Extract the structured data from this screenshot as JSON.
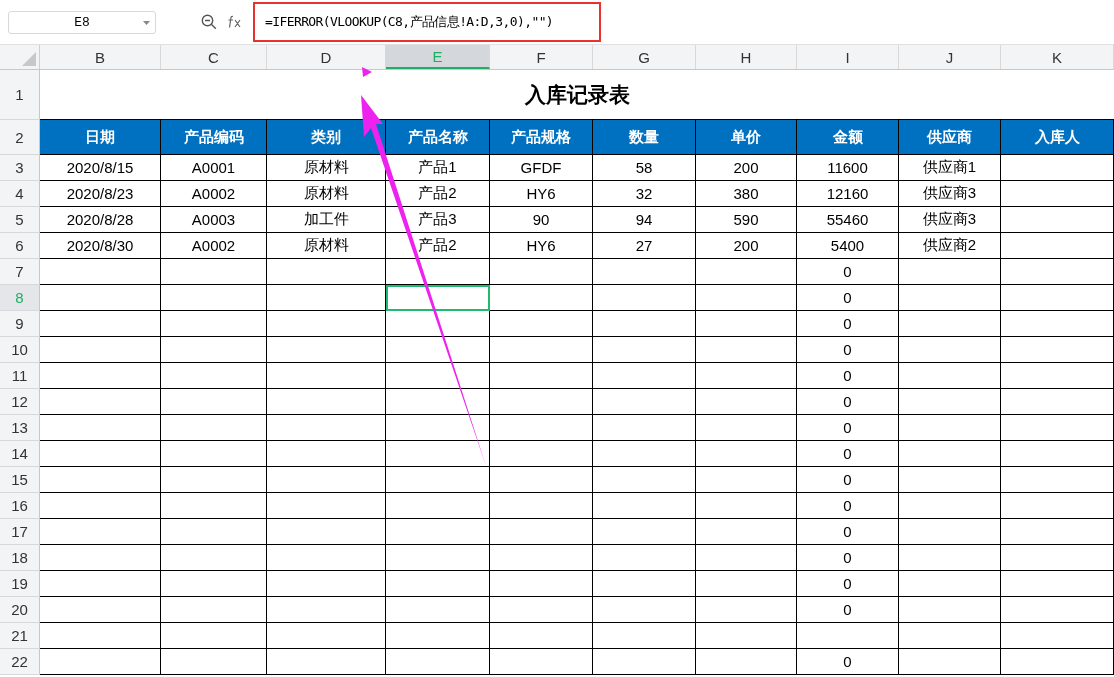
{
  "name_box": {
    "value": "E8"
  },
  "formula": "=IFERROR(VLOOKUP(C8,产品信息!A:D,3,0),\"\")",
  "columns": [
    {
      "label": "B",
      "selected": false
    },
    {
      "label": "C",
      "selected": false
    },
    {
      "label": "D",
      "selected": false
    },
    {
      "label": "E",
      "selected": true
    },
    {
      "label": "F",
      "selected": false
    },
    {
      "label": "G",
      "selected": false
    },
    {
      "label": "H",
      "selected": false
    },
    {
      "label": "I",
      "selected": false
    },
    {
      "label": "J",
      "selected": false
    },
    {
      "label": "K",
      "selected": false
    }
  ],
  "title_row": {
    "number": "1",
    "title": "入库记录表"
  },
  "header_row": {
    "number": "2",
    "cells": [
      "日期",
      "产品编码",
      "类别",
      "产品名称",
      "产品规格",
      "数量",
      "单价",
      "金额",
      "供应商",
      "入库人"
    ]
  },
  "rows": [
    {
      "number": "3",
      "selected": false,
      "cells": [
        "2020/8/15",
        "A0001",
        "原材料",
        "产品1",
        "GFDF",
        "58",
        "200",
        "11600",
        "供应商1",
        null
      ]
    },
    {
      "number": "4",
      "selected": false,
      "cells": [
        "2020/8/23",
        "A0002",
        "原材料",
        "产品2",
        "HY6",
        "32",
        "380",
        "12160",
        "供应商3",
        null
      ]
    },
    {
      "number": "5",
      "selected": false,
      "cells": [
        "2020/8/28",
        "A0003",
        "加工件",
        "产品3",
        "90",
        "94",
        "590",
        "55460",
        "供应商3",
        null
      ]
    },
    {
      "number": "6",
      "selected": false,
      "cells": [
        "2020/8/30",
        "A0002",
        "原材料",
        "产品2",
        "HY6",
        "27",
        "200",
        "5400",
        "供应商2",
        null
      ]
    },
    {
      "number": "7",
      "selected": false,
      "cells": [
        null,
        null,
        null,
        null,
        null,
        null,
        null,
        "0",
        null,
        null
      ]
    },
    {
      "number": "8",
      "selected": true,
      "cells": [
        null,
        null,
        null,
        null,
        null,
        null,
        null,
        "0",
        null,
        null
      ]
    },
    {
      "number": "9",
      "selected": false,
      "cells": [
        null,
        null,
        null,
        null,
        null,
        null,
        null,
        "0",
        null,
        null
      ]
    },
    {
      "number": "10",
      "selected": false,
      "cells": [
        null,
        null,
        null,
        null,
        null,
        null,
        null,
        "0",
        null,
        null
      ]
    },
    {
      "number": "11",
      "selected": false,
      "cells": [
        null,
        null,
        null,
        null,
        null,
        null,
        null,
        "0",
        null,
        null
      ]
    },
    {
      "number": "12",
      "selected": false,
      "cells": [
        null,
        null,
        null,
        null,
        null,
        null,
        null,
        "0",
        null,
        null
      ]
    },
    {
      "number": "13",
      "selected": false,
      "cells": [
        null,
        null,
        null,
        null,
        null,
        null,
        null,
        "0",
        null,
        null
      ]
    },
    {
      "number": "14",
      "selected": false,
      "cells": [
        null,
        null,
        null,
        null,
        null,
        null,
        null,
        "0",
        null,
        null
      ]
    },
    {
      "number": "15",
      "selected": false,
      "cells": [
        null,
        null,
        null,
        null,
        null,
        null,
        null,
        "0",
        null,
        null
      ]
    },
    {
      "number": "16",
      "selected": false,
      "cells": [
        null,
        null,
        null,
        null,
        null,
        null,
        null,
        "0",
        null,
        null
      ]
    },
    {
      "number": "17",
      "selected": false,
      "cells": [
        null,
        null,
        null,
        null,
        null,
        null,
        null,
        "0",
        null,
        null
      ]
    },
    {
      "number": "18",
      "selected": false,
      "cells": [
        null,
        null,
        null,
        null,
        null,
        null,
        null,
        "0",
        null,
        null
      ]
    },
    {
      "number": "19",
      "selected": false,
      "cells": [
        null,
        null,
        null,
        null,
        null,
        null,
        null,
        "0",
        null,
        null
      ]
    },
    {
      "number": "20",
      "selected": false,
      "cells": [
        null,
        null,
        null,
        null,
        null,
        null,
        null,
        "0",
        null,
        null
      ]
    },
    {
      "number": "21",
      "selected": false,
      "cells": [
        null,
        null,
        null,
        null,
        null,
        null,
        null,
        null,
        null,
        null
      ]
    },
    {
      "number": "22",
      "selected": false,
      "cells": [
        null,
        null,
        null,
        null,
        null,
        null,
        null,
        "0",
        null,
        null
      ]
    }
  ]
}
